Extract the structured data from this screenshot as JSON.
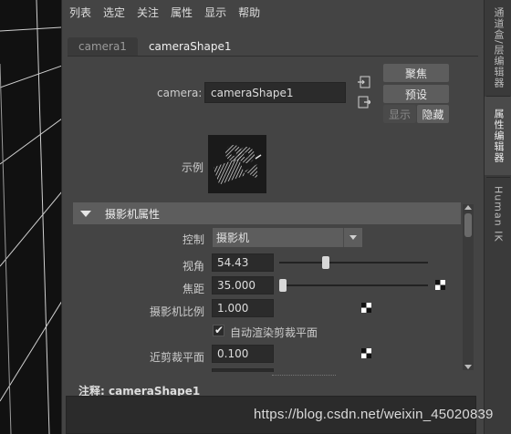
{
  "menubar": {
    "items": [
      "列表",
      "选定",
      "关注",
      "属性",
      "显示",
      "帮助"
    ]
  },
  "tabs": [
    {
      "label": "camera1",
      "active": false
    },
    {
      "label": "cameraShape1",
      "active": true
    }
  ],
  "node": {
    "type_label": "camera:",
    "name_value": "cameraShape1"
  },
  "buttons": {
    "focus": "聚焦",
    "preset": "预设",
    "show": "显示",
    "hide": "隐藏"
  },
  "sample": {
    "label": "示例"
  },
  "section": {
    "title": "摄影机属性"
  },
  "attributes": {
    "control_label": "控制",
    "control_value": "摄影机",
    "angle_of_view_label": "视角",
    "angle_of_view_value": "54.43",
    "angle_of_view_fraction": 0.3,
    "focal_length_label": "焦距",
    "focal_length_value": "35.000",
    "focal_length_fraction": 0.0,
    "camera_scale_label": "摄影机比例",
    "camera_scale_value": "1.000",
    "auto_clip_label": "自动渲染剪裁平面",
    "auto_clip_checked": true,
    "near_clip_label": "近剪裁平面",
    "near_clip_value": "0.100"
  },
  "notes": {
    "label": "注释:",
    "node_name": "cameraShape1"
  },
  "side_tabs": [
    "通道盒/层编辑器",
    "属性编辑器",
    "Human IK"
  ],
  "watermark": "https://blog.csdn.net/weixin_45020839",
  "colors": {
    "panel_bg": "#444444",
    "field_bg": "#2b2b2b",
    "section_header": "#5d5d5d",
    "viewport_bg": "#111111"
  }
}
